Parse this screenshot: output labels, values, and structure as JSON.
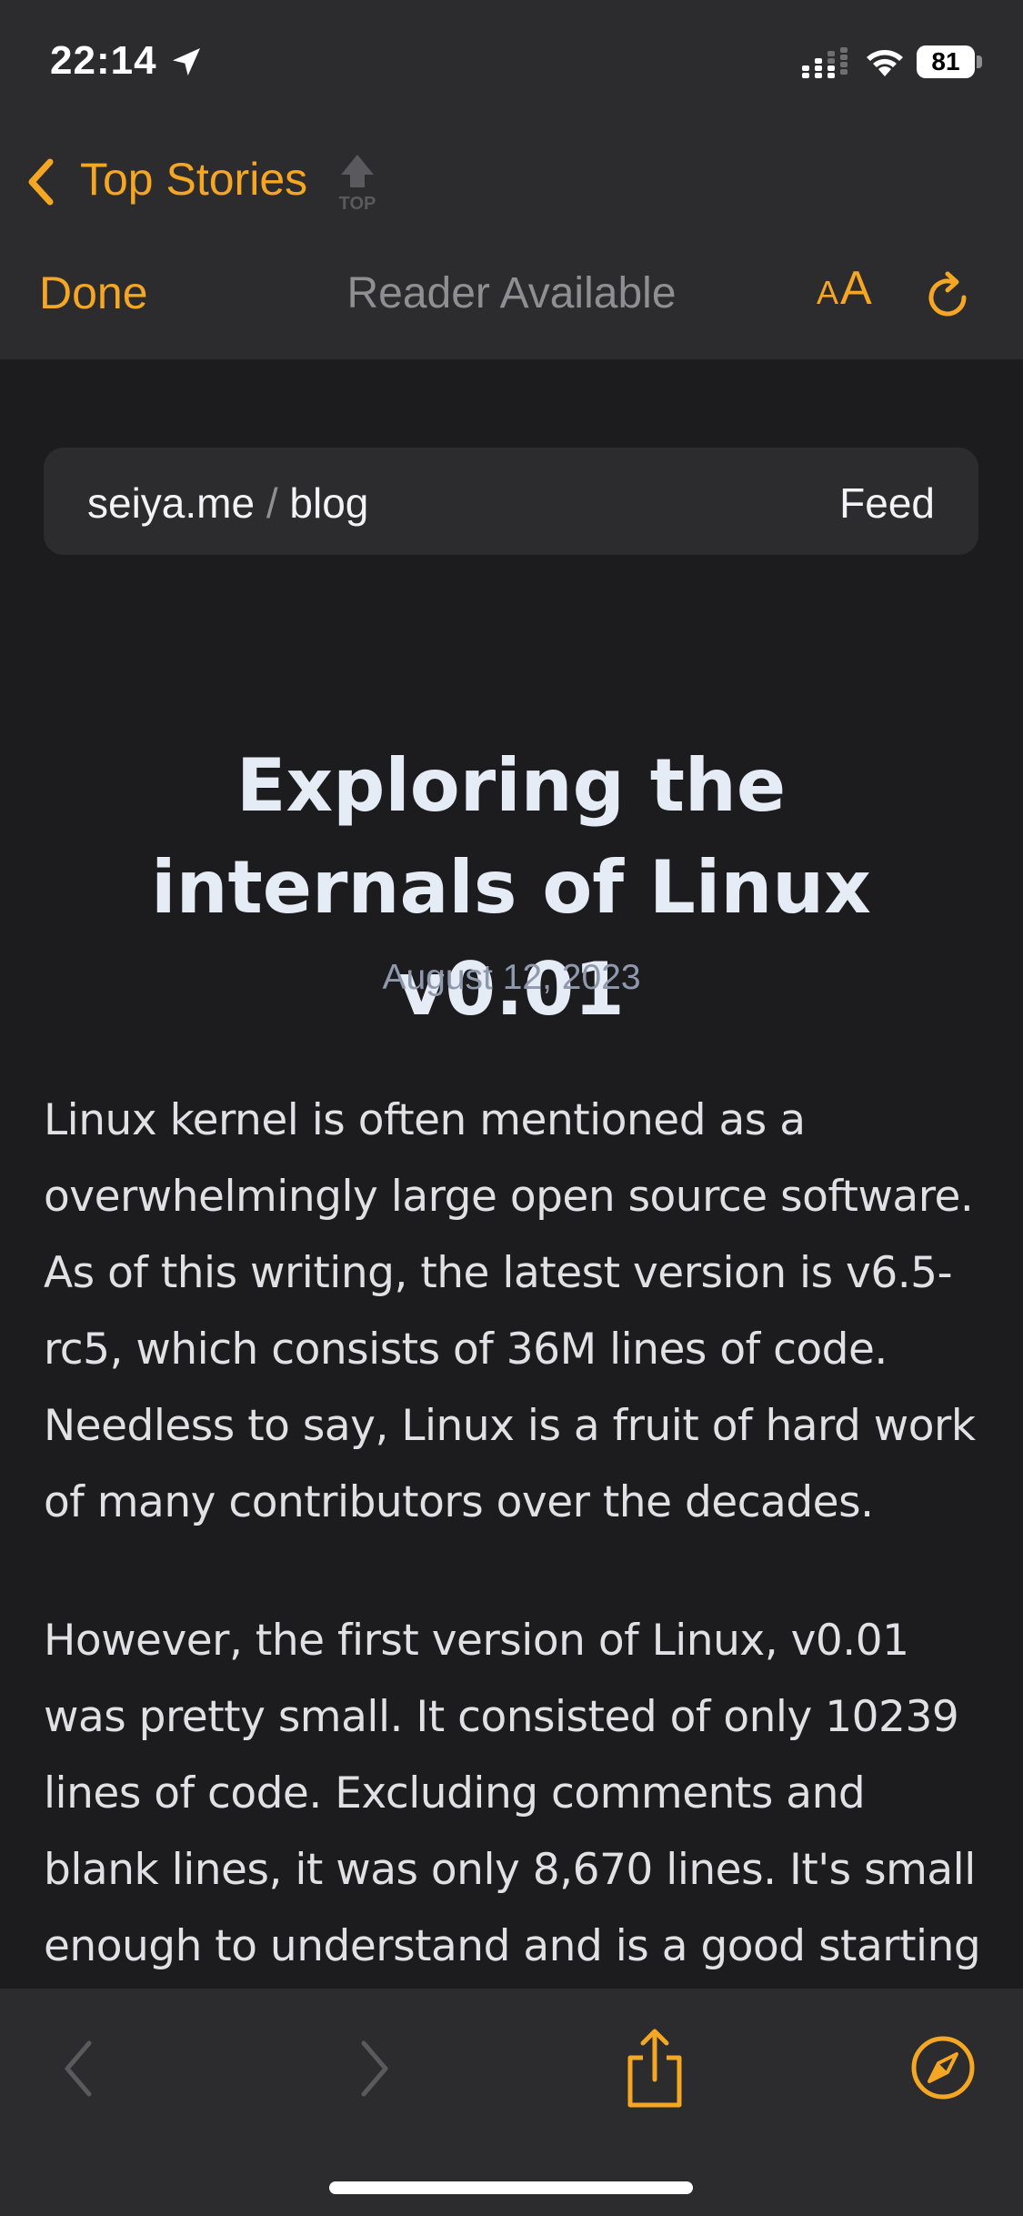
{
  "status_bar": {
    "time": "22:14",
    "battery": "81",
    "icons": [
      "location-arrow-icon",
      "signal-icon",
      "wifi-icon",
      "battery-icon"
    ]
  },
  "nav": {
    "back_label": "Top Stories",
    "top_label": "TOP"
  },
  "toolbar": {
    "done_label": "Done",
    "center_text": "Reader Available",
    "text_size_small": "A",
    "text_size_large": "A"
  },
  "site": {
    "domain": "seiya.me",
    "separator": "/",
    "section": "blog",
    "feed_label": "Feed"
  },
  "article": {
    "title": "Exploring the internals of Linux v0.01",
    "date": "August 12, 2023",
    "paragraphs": [
      "Linux kernel is often mentioned as a overwhelmingly large open source software. As of this writing, the latest version is v6.5-rc5, which consists of 36M lines of code. Needless to say, Linux is a fruit of hard work of many contributors over the decades.",
      "However, the first version of Linux, v0.01 was pretty small. It consisted of only 10239 lines of code. Excluding comments and blank lines, it was only 8,670 lines. It's small enough to understand and is a good starting point to"
    ]
  },
  "colors": {
    "accent": "#f5a623",
    "background": "#1c1c1e",
    "chrome": "#2c2c2e",
    "title": "#e6ecf5",
    "date": "#8f99ad"
  }
}
